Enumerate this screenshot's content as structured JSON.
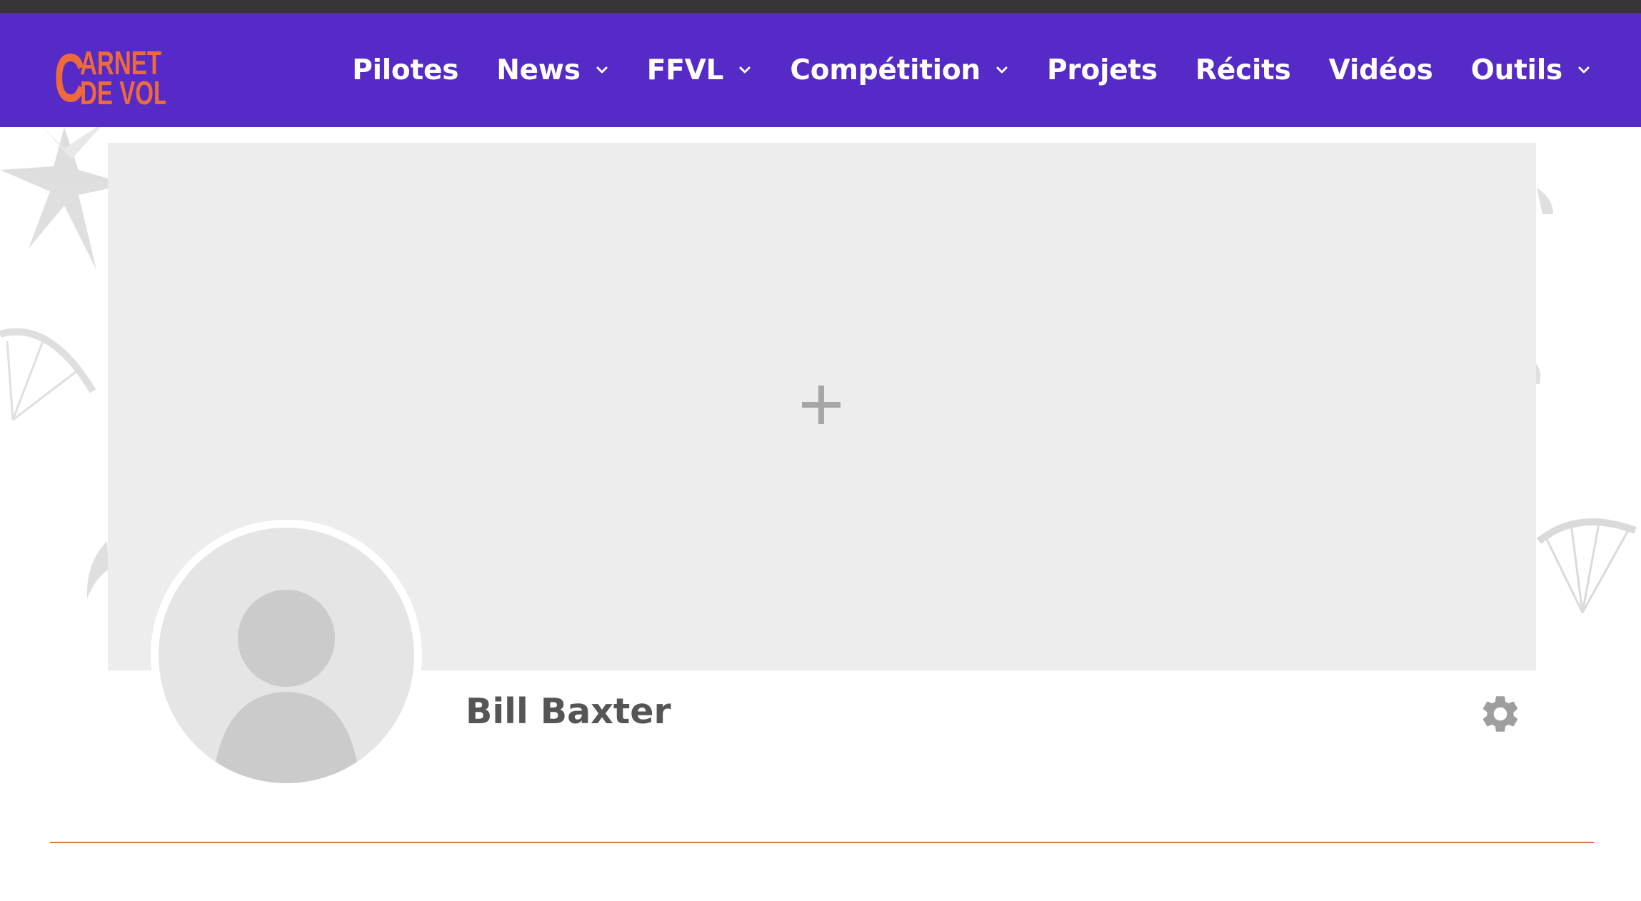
{
  "logo": {
    "line1": "ARNET",
    "line2": "DE VOL",
    "initial": "C"
  },
  "nav": {
    "items": [
      {
        "label": "Pilotes",
        "has_dropdown": false
      },
      {
        "label": "News",
        "has_dropdown": true
      },
      {
        "label": "FFVL",
        "has_dropdown": true
      },
      {
        "label": "Compétition",
        "has_dropdown": true
      },
      {
        "label": "Projets",
        "has_dropdown": false
      },
      {
        "label": "Récits",
        "has_dropdown": false
      },
      {
        "label": "Vidéos",
        "has_dropdown": false
      },
      {
        "label": "Outils",
        "has_dropdown": true
      }
    ]
  },
  "profile": {
    "name": "Bill Baxter"
  },
  "colors": {
    "topbar": "#37353a",
    "navbar": "#552ac7",
    "logo": "#ee6a3a",
    "cover": "#ededed",
    "divider": "#d8773e",
    "name_text": "#555555",
    "icon_gray": "#9e9e9e"
  },
  "icons": {
    "cover_add": "plus-icon",
    "settings": "gear-icon",
    "dropdown": "chevron-down-icon",
    "avatar": "default-user-icon"
  }
}
